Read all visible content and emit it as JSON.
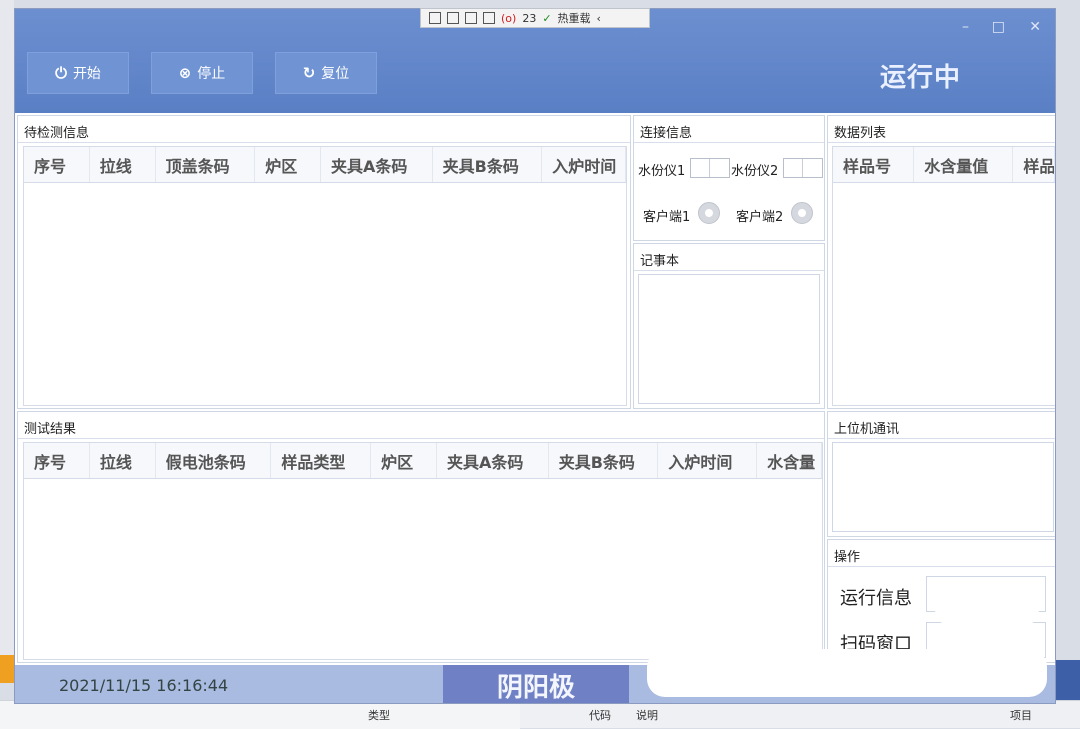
{
  "debug_toolbar": {
    "count": "23",
    "hot_reload": "热重载"
  },
  "header": {
    "buttons": [
      {
        "label": "开始",
        "icon": "power-icon"
      },
      {
        "label": "停止",
        "icon": "stop-icon"
      },
      {
        "label": "复位",
        "icon": "reset-icon"
      }
    ],
    "status": "运行中"
  },
  "pending_panel": {
    "title": "待检测信息",
    "columns": [
      "序号",
      "拉线",
      "顶盖条码",
      "炉区",
      "夹具A条码",
      "夹具B条码",
      "入炉时间"
    ]
  },
  "connection_panel": {
    "title": "连接信息",
    "meter1": "水份仪1",
    "meter2": "水份仪2",
    "client1": "客户端1",
    "client2": "客户端2"
  },
  "notes_panel": {
    "title": "记事本"
  },
  "data_list_panel": {
    "title": "数据列表",
    "columns": [
      "样品号",
      "水含量值",
      "样品"
    ]
  },
  "results_panel": {
    "title": "测试结果",
    "columns": [
      "序号",
      "拉线",
      "假电池条码",
      "样品类型",
      "炉区",
      "夹具A条码",
      "夹具B条码",
      "入炉时间",
      "水含量"
    ]
  },
  "host_comm_panel": {
    "title": "上位机通讯"
  },
  "operation_panel": {
    "title": "操作",
    "run_info": "运行信息",
    "scan_window": "扫码窗口"
  },
  "footer": {
    "datetime": "2021/11/15 16:16:44",
    "mode": "阴阳极"
  },
  "ide": {
    "type_label": "类型",
    "code_label": "代码",
    "desc_label": "说明",
    "project_label": "项目"
  }
}
